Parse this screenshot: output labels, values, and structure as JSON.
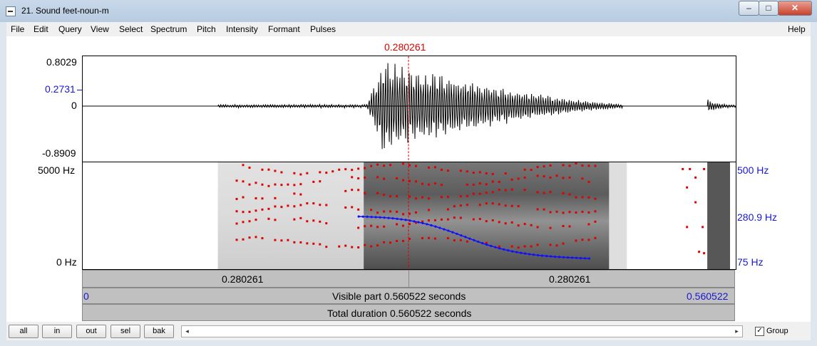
{
  "window": {
    "title": "21. Sound feet-noun-m",
    "minimize": "–",
    "maximize": "□",
    "close": "✕",
    "icon": "sound-window-icon"
  },
  "menu": {
    "items": [
      "File",
      "Edit",
      "Query",
      "View",
      "Select",
      "Spectrum",
      "Pitch",
      "Intensity",
      "Formant",
      "Pulses"
    ],
    "help": "Help"
  },
  "cursor": {
    "time": "0.280261",
    "color": "#e00000"
  },
  "waveform": {
    "max": "0.8029",
    "cursor_value": "0.2731",
    "zero": "0",
    "min": "-0.8909"
  },
  "spectrogram": {
    "freq_top": "5000 Hz",
    "freq_bottom": "0 Hz",
    "pitch_top": "500 Hz",
    "pitch_cursor": "280.9 Hz",
    "pitch_bottom": "75 Hz",
    "pitch_color": "#1010ff",
    "formant_color": "#e00000"
  },
  "time_bars": {
    "left_segment": "0.280261",
    "right_segment": "0.280261",
    "visible_start": "0",
    "visible_label": "Visible part 0.560522 seconds",
    "visible_end": "0.560522",
    "total_label": "Total duration 0.560522 seconds"
  },
  "navigation": {
    "buttons": [
      "all",
      "in",
      "out",
      "sel",
      "bak"
    ],
    "scroll_left": "◂",
    "scroll_right": "▸",
    "group_checked": "✓",
    "group_label": "Group"
  }
}
